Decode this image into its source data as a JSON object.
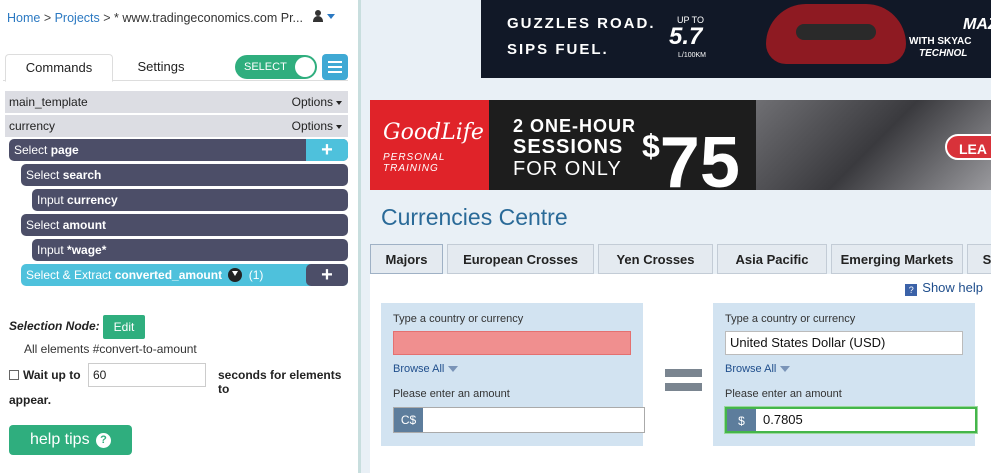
{
  "breadcrumb": {
    "home": "Home",
    "sep": " > ",
    "projects": "Projects",
    "project": "* www.tradingeconomics.com Pr..."
  },
  "tabs": {
    "commands": "Commands",
    "settings": "Settings"
  },
  "toggle": {
    "label": "SELECT",
    "state": "on"
  },
  "templates": [
    {
      "name": "main_template",
      "options": "Options"
    },
    {
      "name": "currency",
      "options": "Options"
    }
  ],
  "commands": [
    {
      "prefix": "Select ",
      "target": "page"
    },
    {
      "prefix": "Select ",
      "target": "search"
    },
    {
      "prefix": "Input ",
      "target": "currency"
    },
    {
      "prefix": "Select ",
      "target": "amount"
    },
    {
      "prefix": "Input ",
      "target": "*wage*"
    },
    {
      "prefix": "Select & Extract ",
      "target": "converted_amount",
      "count": "(1)"
    }
  ],
  "selection": {
    "label": "Selection Node:",
    "edit": "Edit",
    "elements": "All elements #convert-to-amount",
    "wait_label": "Wait up to",
    "wait_value": "60",
    "wait_after": "seconds for elements to",
    "appear": "appear."
  },
  "help_tips": "help tips",
  "ads": {
    "car": {
      "line1": "GUZZLES ROAD.",
      "line2": "SIPS FUEL.",
      "upto": "UP TO",
      "value": "5.7",
      "unit": "L/100KM",
      "brand": "MAZ",
      "brand2": "WITH SKYAC",
      "brand3": "TECHNOL"
    },
    "gym": {
      "logo1": "GoodLife",
      "logo2": "PERSONAL TRAINING",
      "l1": "2 ONE-HOUR",
      "l2": "SESSIONS",
      "l3": "FOR ONLY",
      "currency": "$",
      "price": "75",
      "cta": "LEA"
    }
  },
  "page_title": "Currencies Centre",
  "currency_tabs": [
    "Majors",
    "European Crosses",
    "Yen Crosses",
    "Asia Pacific",
    "Emerging Markets",
    "S"
  ],
  "show_help": "Show help",
  "converter": {
    "left": {
      "type_label": "Type a country or currency",
      "value": "",
      "browse": "Browse All",
      "amount_label": "Please enter an amount",
      "currency": "C$",
      "amount": ""
    },
    "right": {
      "type_label": "Type a country or currency",
      "value": "United States Dollar (USD)",
      "browse": "Browse All",
      "amount_label": "Please enter an amount",
      "currency": "$",
      "amount": "0.7805"
    }
  },
  "colors": {
    "green": "#2fae7e",
    "cmd": "#4c4e68",
    "cyan": "#4ec1dc",
    "link": "#2b79c2",
    "error": "#f08f8f"
  }
}
